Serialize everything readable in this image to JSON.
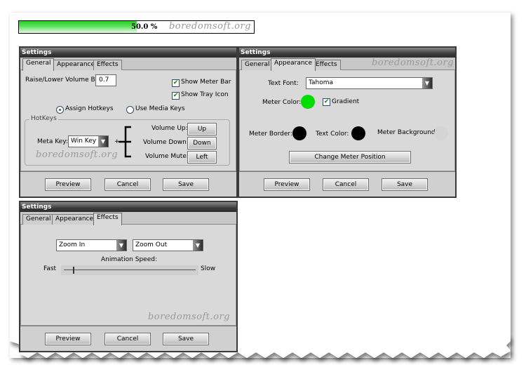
{
  "meter": {
    "percent": 50.0,
    "text": "50.0 %",
    "watermark": "boredomsoft.org",
    "fill_color": "#22d022"
  },
  "windows": {
    "general": {
      "title": "Settings",
      "tabs": [
        {
          "label": "General",
          "active": true
        },
        {
          "label": "Appearance",
          "active": false
        },
        {
          "label": "Effects",
          "active": false
        }
      ],
      "volume_step_label": "Raise/Lower Volume By:",
      "volume_step_value": "0.7",
      "show_meter_bar": {
        "label": "Show Meter Bar",
        "checked": true
      },
      "show_tray_icon": {
        "label": "Show Tray Icon",
        "checked": true
      },
      "radio_assign_hotkeys": {
        "label": "Assign Hotkeys",
        "selected": true
      },
      "radio_media_keys": {
        "label": "Use Media Keys",
        "selected": false
      },
      "hotkeys": {
        "group_label": "HotKeys",
        "meta_key_label": "Meta Key:",
        "meta_key_value": "Win Key",
        "plus": "+",
        "volume_up_label": "Volume Up:",
        "volume_up_value": "Up",
        "volume_down_label": "Volume Down:",
        "volume_down_value": "Down",
        "volume_mute_label": "Volume Mute:",
        "volume_mute_value": "Left"
      },
      "watermark": "boredomsoft.org",
      "buttons": {
        "preview": "Preview",
        "cancel": "Cancel",
        "save": "Save"
      }
    },
    "appearance": {
      "title": "Settings",
      "tabs": [
        {
          "label": "General",
          "active": false
        },
        {
          "label": "Appearance",
          "active": true
        },
        {
          "label": "Effects",
          "active": false
        }
      ],
      "watermark": "boredomsoft.org",
      "text_font_label": "Text Font:",
      "text_font_value": "Tahoma",
      "meter_color_label": "Meter Color:",
      "meter_color": "#00dd00",
      "gradient": {
        "label": "Gradient",
        "checked": true
      },
      "meter_border_label": "Meter Border:",
      "meter_border_color": "#000000",
      "text_color_label": "Text Color:",
      "text_color": "#000000",
      "meter_background_label": "Meter Background:",
      "meter_background_color": "#d4d4d4",
      "change_position_button": "Change Meter Position",
      "buttons": {
        "preview": "Preview",
        "cancel": "Cancel",
        "save": "Save"
      }
    },
    "effects": {
      "title": "Settings",
      "tabs": [
        {
          "label": "General",
          "active": false
        },
        {
          "label": "Appearance",
          "active": false
        },
        {
          "label": "Effects",
          "active": true
        }
      ],
      "show_effect_value": "Zoom In",
      "hide_effect_value": "Zoom Out",
      "animation_speed_label": "Animation Speed:",
      "speed_min_label": "Fast",
      "speed_max_label": "Slow",
      "speed_value_fraction": 0.07,
      "watermark": "boredomsoft.org",
      "buttons": {
        "preview": "Preview",
        "cancel": "Cancel",
        "save": "Save"
      }
    }
  }
}
